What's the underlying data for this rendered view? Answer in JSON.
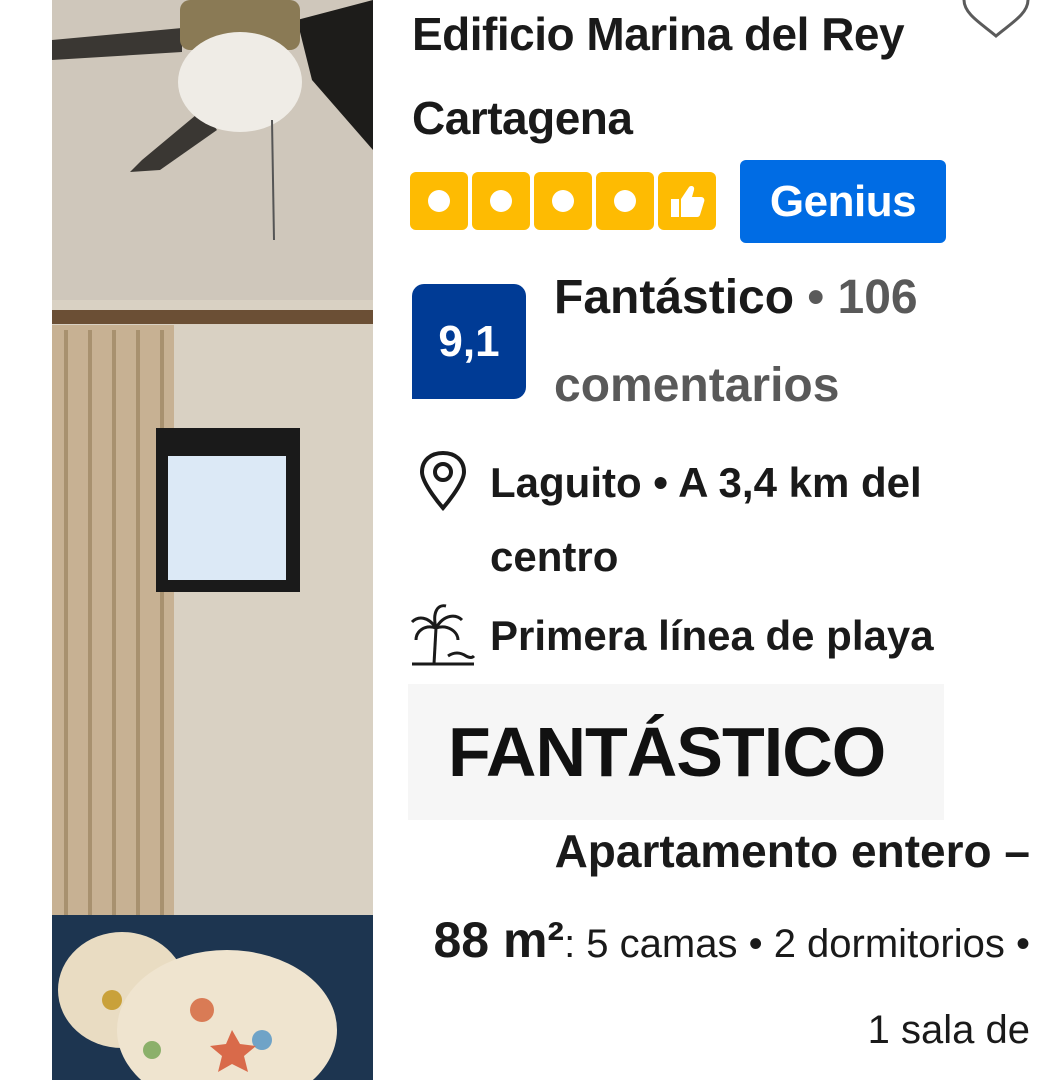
{
  "property": {
    "title": "Edificio Marina del Rey Cartagena",
    "save_icon": "heart-outline-icon",
    "quality_icons": [
      "square-icon",
      "square-icon",
      "square-icon",
      "square-icon",
      "thumbs-up-icon"
    ],
    "genius_label": "Genius",
    "score": "9,1",
    "score_label": "Fantástico",
    "separator": "•",
    "review_count": "106",
    "reviews_label": "comentarios",
    "location_icon": "map-pin-icon",
    "location_text": "Laguito • A 3,4 km del centro",
    "beach_icon": "palm-tree-icon",
    "beach_text": "Primera línea de playa",
    "highlight_badge": "FANTÁSTICO",
    "description_part1": "Apartamento entero –",
    "description_size": "88 m²",
    "description_rest": ": 5 camas • 2 dormitorios • 1 sala de"
  },
  "colors": {
    "brand_yellow": "#febb02",
    "genius_blue": "#006ce4",
    "score_blue": "#003b95",
    "muted_text": "#595959"
  }
}
